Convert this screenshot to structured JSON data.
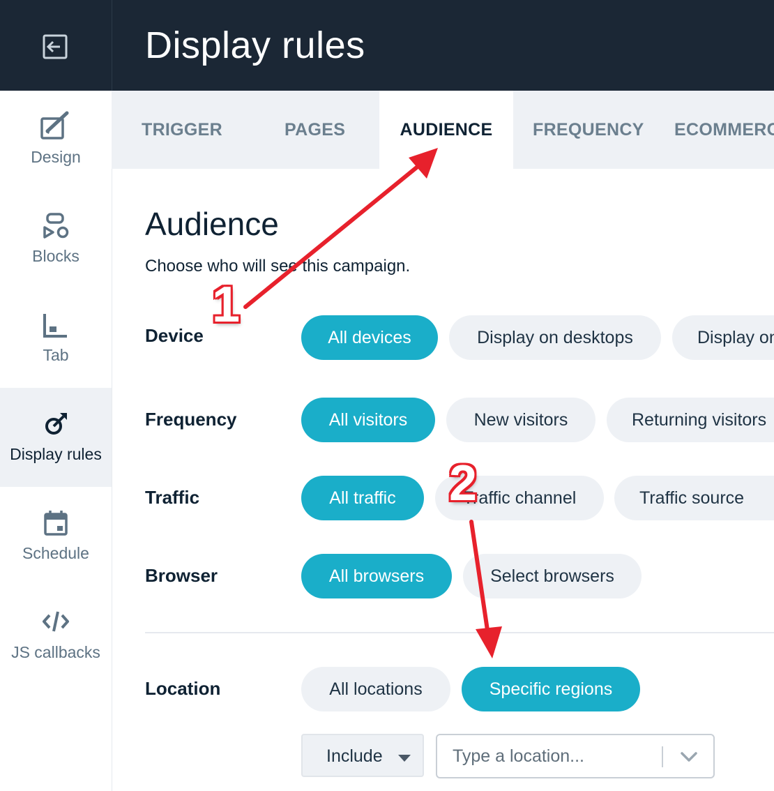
{
  "header": {
    "title": "Display rules",
    "back_icon": "exit-icon"
  },
  "sidebar": {
    "items": [
      {
        "label": "Design",
        "icon": "paint-brush-icon"
      },
      {
        "label": "Blocks",
        "icon": "blocks-icon"
      },
      {
        "label": "Tab",
        "icon": "tab-icon"
      },
      {
        "label": "Display rules",
        "icon": "target-icon",
        "active": true
      },
      {
        "label": "Schedule",
        "icon": "calendar-icon"
      },
      {
        "label": "JS callbacks",
        "icon": "code-icon"
      }
    ]
  },
  "tabs": [
    {
      "label": "TRIGGER"
    },
    {
      "label": "PAGES"
    },
    {
      "label": "AUDIENCE",
      "active": true
    },
    {
      "label": "FREQUENCY"
    },
    {
      "label": "ECOMMERCE"
    }
  ],
  "audience": {
    "heading": "Audience",
    "subtitle": "Choose who will see this campaign."
  },
  "rows": {
    "device": {
      "label": "Device",
      "options": [
        "All devices",
        "Display on desktops",
        "Display on mobiles"
      ],
      "selected": "All devices"
    },
    "frequency": {
      "label": "Frequency",
      "options": [
        "All visitors",
        "New visitors",
        "Returning visitors"
      ],
      "selected": "All visitors"
    },
    "traffic": {
      "label": "Traffic",
      "options": [
        "All traffic",
        "Traffic channel",
        "Traffic source"
      ],
      "selected": "All traffic"
    },
    "browser": {
      "label": "Browser",
      "options": [
        "All browsers",
        "Select browsers"
      ],
      "selected": "All browsers"
    },
    "location": {
      "label": "Location",
      "options": [
        "All locations",
        "Specific regions"
      ],
      "selected": "Specific regions"
    }
  },
  "location_filter": {
    "mode": "Include",
    "placeholder": "Type a location..."
  },
  "annotations": {
    "step1": "1",
    "step2": "2",
    "arrow_color": "#e7212c"
  },
  "colors": {
    "accent": "#1aaec9",
    "header_bg": "#1b2735",
    "tab_bg": "#eef1f5"
  }
}
